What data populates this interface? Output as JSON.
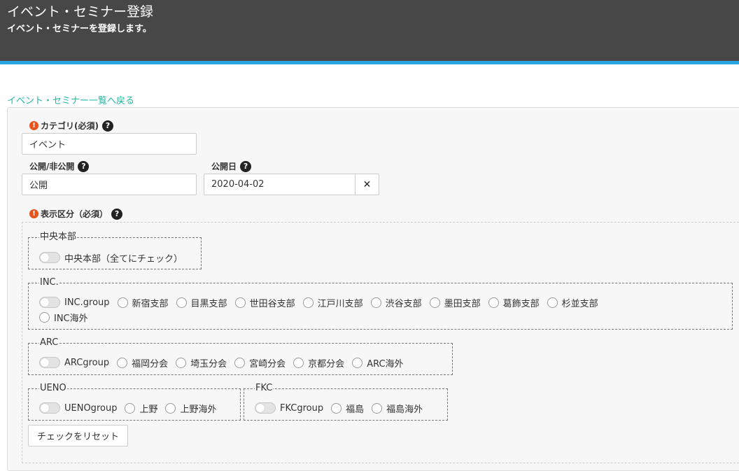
{
  "header": {
    "title": "イベント・セミナー登録",
    "subtitle": "イベント・セミナーを登録します。"
  },
  "back_link": "イベント・セミナー一覧へ戻る",
  "form": {
    "category": {
      "label": "カテゴリ(必須)",
      "value": "イベント"
    },
    "visibility": {
      "label": "公開/非公開",
      "value": "公開"
    },
    "publish_date": {
      "label": "公開日",
      "value": "2020-04-02"
    },
    "display_section": {
      "label": "表示区分（必須）"
    }
  },
  "groups": {
    "chuo": {
      "legend": "中央本部",
      "toggle_label": "中央本部（全てにチェック）"
    },
    "inc": {
      "legend": "INC.",
      "toggle_label": "INC.group",
      "options": [
        "新宿支部",
        "目黒支部",
        "世田谷支部",
        "江戸川支部",
        "渋谷支部",
        "墨田支部",
        "葛飾支部",
        "杉並支部",
        "INC海外"
      ]
    },
    "arc": {
      "legend": "ARC",
      "toggle_label": "ARCgroup",
      "options": [
        "福岡分会",
        "埼玉分会",
        "宮崎分会",
        "京都分会",
        "ARC海外"
      ]
    },
    "ueno": {
      "legend": "UENO",
      "toggle_label": "UENOgroup",
      "options": [
        "上野",
        "上野海外"
      ]
    },
    "fkc": {
      "legend": "FKC",
      "toggle_label": "FKCgroup",
      "options": [
        "福島",
        "福島海外"
      ]
    }
  },
  "reset_button": "チェックをリセット",
  "icons": {
    "required": "exclamation-circle",
    "help": "question-circle",
    "clear": "times"
  },
  "colors": {
    "header_bg": "#474747",
    "header_accent": "#2aa4dc",
    "link": "#1fb9a2",
    "required": "#e8531c"
  }
}
